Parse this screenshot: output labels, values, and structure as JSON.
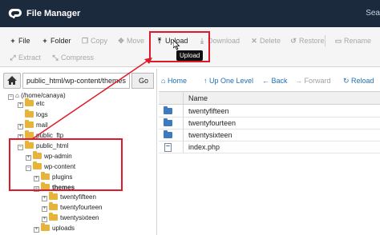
{
  "header": {
    "title": "File Manager",
    "search_hint": "Sea"
  },
  "toolbar": {
    "file": "File",
    "folder": "Folder",
    "copy": "Copy",
    "move": "Move",
    "upload": "Upload",
    "download": "Download",
    "delete": "Delete",
    "restore": "Restore",
    "rename": "Rename",
    "extract": "Extract",
    "compress": "Compress",
    "tooltip": "Upload"
  },
  "pathbar": {
    "value": "public_html/wp-content/themes",
    "go": "Go"
  },
  "tree": {
    "root": "(/home/canaya)",
    "etc": "etc",
    "logs": "logs",
    "mail": "mail",
    "public_ftp": "public_ftp",
    "public_html": "public_html",
    "wp_admin": "wp-admin",
    "wp_content": "wp-content",
    "plugins": "plugins",
    "themes": "themes",
    "twentyfifteen": "twentyfifteen",
    "twentyfourteen": "twentyfourteen",
    "twentysixteen": "twentysixteen",
    "uploads": "uploads"
  },
  "nav": {
    "home": "Home",
    "up": "Up One Level",
    "back": "Back",
    "forward": "Forward",
    "reload": "Reload"
  },
  "table": {
    "header_name": "Name",
    "rows": [
      {
        "name": "twentyfifteen",
        "kind": "folder"
      },
      {
        "name": "twentyfourteen",
        "kind": "folder"
      },
      {
        "name": "twentysixteen",
        "kind": "folder"
      },
      {
        "name": "index.php",
        "kind": "file"
      }
    ]
  },
  "colors": {
    "header_bg": "#1c2a3e",
    "link_blue": "#1f6fb5",
    "folder_yellow": "#e8b33a",
    "folder_blue": "#3d7bbf",
    "annotation_red": "#e0192a"
  }
}
